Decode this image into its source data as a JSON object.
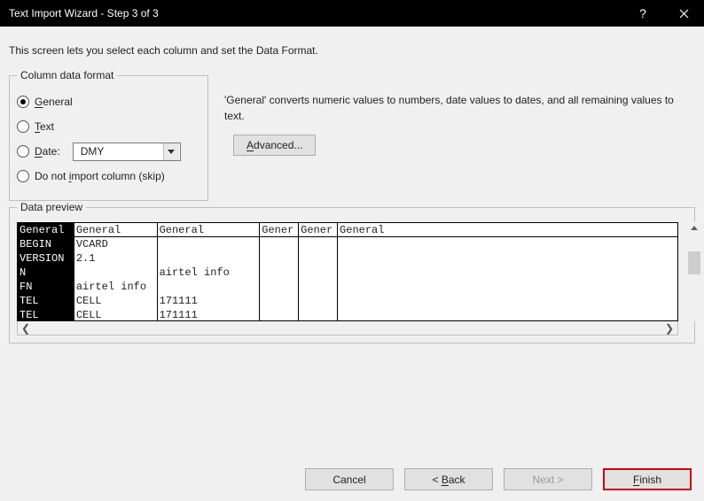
{
  "titlebar": {
    "title": "Text Import Wizard - Step 3 of 3"
  },
  "instruction": "This screen lets you select each column and set the Data Format.",
  "column_format": {
    "legend": "Column data format",
    "options": {
      "general": {
        "label": "General",
        "underline": "G",
        "checked": true
      },
      "text": {
        "label": "Text",
        "underline": "T",
        "checked": false
      },
      "date": {
        "label": "Date:",
        "underline": "D",
        "checked": false,
        "value": "DMY"
      },
      "skip": {
        "label": "Do not import column (skip)",
        "underline": "I",
        "checked": false
      }
    }
  },
  "description": "'General' converts numeric values to numbers, date values to dates, and all remaining values to text.",
  "advanced_label": "Advanced...",
  "preview": {
    "legend": "Data preview",
    "headers": [
      "General",
      "General",
      "General",
      "Gener",
      "Gener",
      "General"
    ],
    "selected_col": 0,
    "rows": [
      [
        "BEGIN",
        "VCARD",
        "",
        "",
        "",
        ""
      ],
      [
        "VERSION",
        "2.1",
        "",
        "",
        "",
        ""
      ],
      [
        "N",
        "",
        "airtel info",
        "",
        "",
        ""
      ],
      [
        "FN",
        "airtel info",
        "",
        "",
        "",
        ""
      ],
      [
        "TEL",
        "CELL",
        "171111",
        "",
        "",
        ""
      ],
      [
        "TEL",
        "CELL",
        "171111",
        "",
        "",
        ""
      ]
    ]
  },
  "footer": {
    "cancel": "Cancel",
    "back": "< Back",
    "next": "Next >",
    "finish": "Finish"
  }
}
